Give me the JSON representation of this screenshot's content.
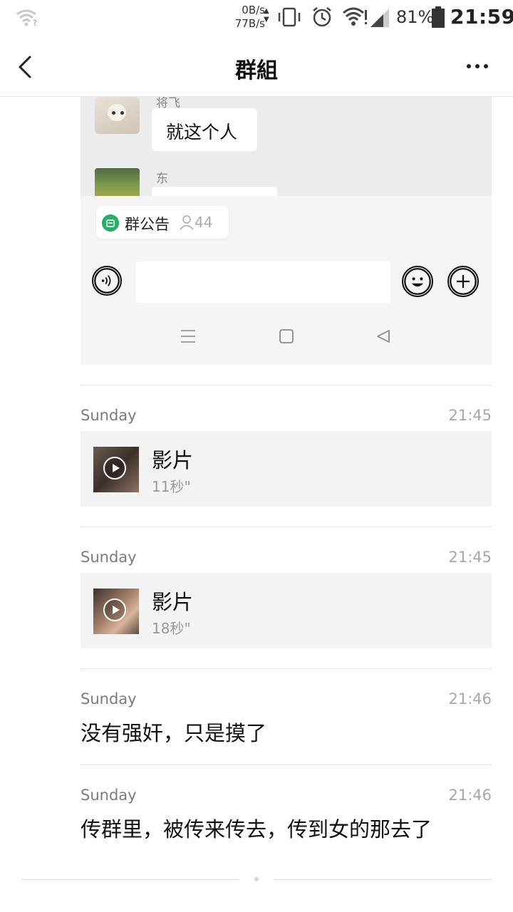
{
  "status_bar": {
    "net_speed_up": "0B/s",
    "net_speed_down": "77B/s",
    "battery": "81%",
    "time": "21:59"
  },
  "nav": {
    "title": "群組"
  },
  "embedded_screenshot": {
    "sender1": "将飞",
    "message1": "就这个人",
    "sender2": "东",
    "notice_label": "群公告",
    "member_count": "44"
  },
  "items": [
    {
      "sender": "Sunday",
      "time": "21:45",
      "type": "video",
      "title": "影片",
      "duration": "11秒\""
    },
    {
      "sender": "Sunday",
      "time": "21:45",
      "type": "video",
      "title": "影片",
      "duration": "18秒\""
    },
    {
      "sender": "Sunday",
      "time": "21:46",
      "type": "text",
      "text": "没有强奸，只是摸了"
    },
    {
      "sender": "Sunday",
      "time": "21:46",
      "type": "text",
      "text": "传群里，被传来传去，传到女的那去了"
    }
  ],
  "colors": {
    "accent_green": "#2aae67",
    "card_bg": "#f3f3f3"
  }
}
